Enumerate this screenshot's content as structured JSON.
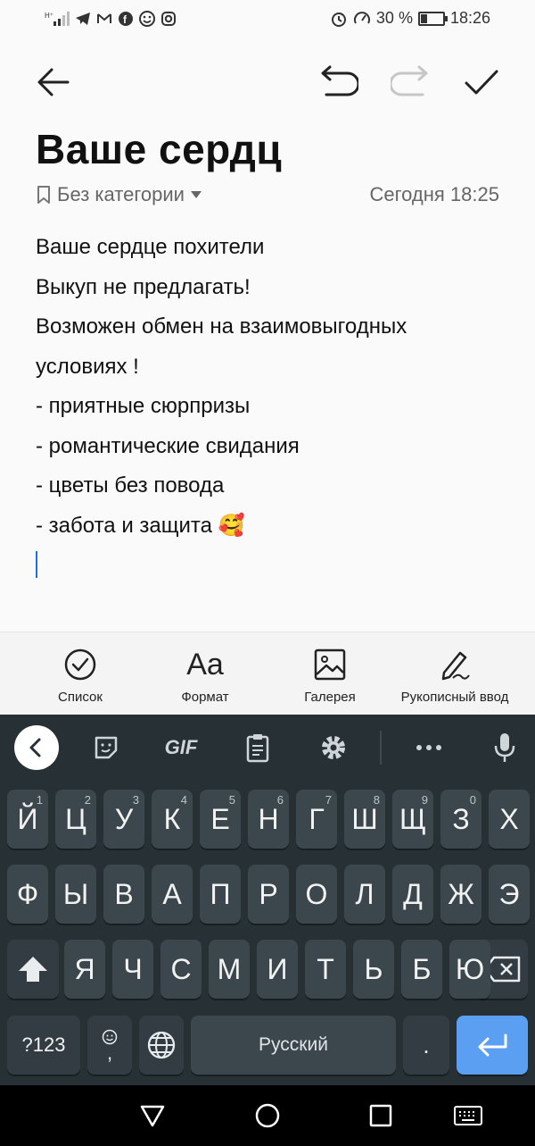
{
  "status_bar": {
    "battery_text": "30 %",
    "battery_level": 0.3,
    "time": "18:26"
  },
  "note": {
    "title": "Ваше сердц",
    "category": "Без категории",
    "date": "Сегодня 18:25",
    "lines": [
      "Ваше сердце похители",
      "Выкуп не предлагать!",
      "Возможен обмен на взаимовыгодных",
      "условиях !",
      "- приятные сюрпризы",
      "- романтические свидания",
      "- цветы без повода",
      "- забота и защита 🥰"
    ]
  },
  "editor_toolbar": {
    "list_label": "Список",
    "format_label": "Формат",
    "format_icon_text": "Aa",
    "gallery_label": "Галерея",
    "handwriting_label": "Рукописный ввод"
  },
  "keyboard": {
    "gif_label": "GIF",
    "row1": [
      "Й",
      "Ц",
      "У",
      "К",
      "Е",
      "Н",
      "Г",
      "Ш",
      "Щ",
      "З",
      "Х"
    ],
    "row1_hints": [
      "1",
      "2",
      "3",
      "4",
      "5",
      "6",
      "7",
      "8",
      "9",
      "0",
      ""
    ],
    "row2": [
      "Ф",
      "Ы",
      "В",
      "А",
      "П",
      "Р",
      "О",
      "Л",
      "Д",
      "Ж",
      "Э"
    ],
    "row3": [
      "Я",
      "Ч",
      "С",
      "М",
      "И",
      "Т",
      "Ь",
      "Б",
      "Ю"
    ],
    "symbols_label": "?123",
    "comma_label": ",",
    "space_label": "Русский",
    "period_label": "."
  },
  "colors": {
    "accent": "#5a9ff2",
    "caret": "#1e6fd9",
    "keyboard_bg": "#263035",
    "key_bg": "#3c474d"
  }
}
